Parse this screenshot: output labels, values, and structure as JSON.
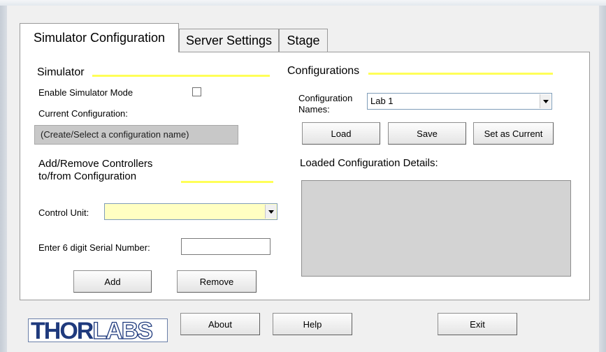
{
  "window": {
    "partial_title_text": "",
    "accent_yellow": "#ffff57",
    "logo_blue": "#1f3a7d"
  },
  "tabs": [
    {
      "label": "Simulator Configuration",
      "active": true
    },
    {
      "label": "Server Settings",
      "active": false
    },
    {
      "label": "Stage",
      "active": false
    }
  ],
  "simulator": {
    "title": "Simulator",
    "enable_label": "Enable Simulator Mode",
    "enable_checked": false,
    "current_config_label": "Current Configuration:",
    "current_config_value": "(Create/Select a configuration name)"
  },
  "controllers": {
    "title_line1": "Add/Remove Controllers",
    "title_line2": "to/from Configuration",
    "control_unit_label": "Control Unit:",
    "control_unit_value": "",
    "serial_label": "Enter 6 digit Serial Number:",
    "serial_value": "",
    "add_label": "Add",
    "remove_label": "Remove"
  },
  "configurations": {
    "title": "Configurations",
    "names_label_line1": "Configuration",
    "names_label_line2": "Names:",
    "names_value": "Lab 1",
    "load_label": "Load",
    "save_label": "Save",
    "set_current_label": "Set as Current",
    "details_label": "Loaded Configuration Details:"
  },
  "footer": {
    "logo_part1": "THOR",
    "logo_part2": "LABS",
    "about_label": "About",
    "help_label": "Help",
    "exit_label": "Exit"
  }
}
